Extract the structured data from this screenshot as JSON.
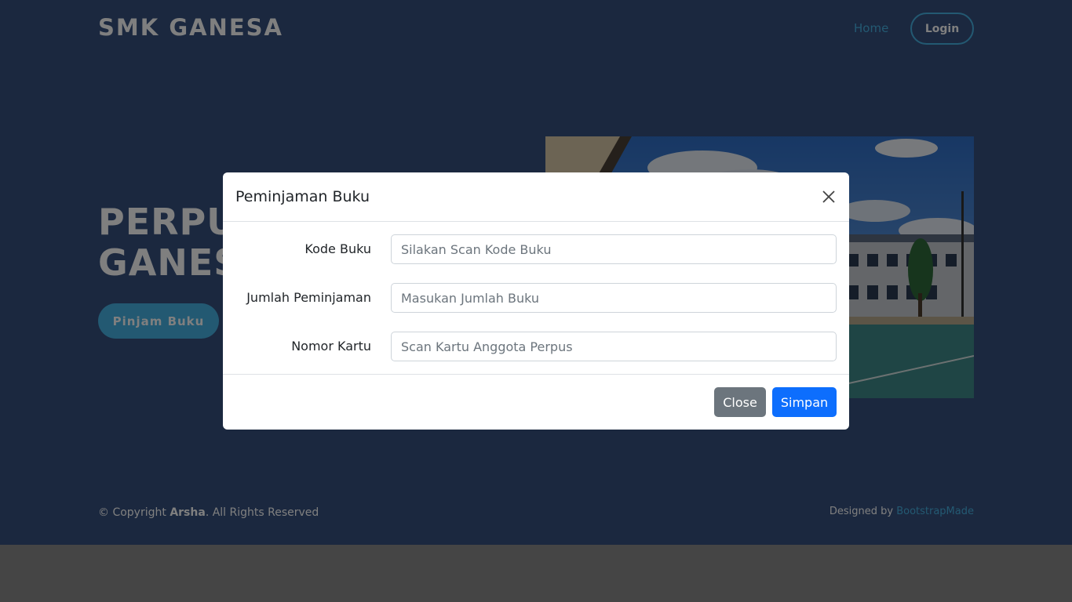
{
  "header": {
    "logo": "SMK GANESA",
    "nav_home": "Home",
    "nav_login": "Login"
  },
  "hero": {
    "title_line1": "PERPUS",
    "title_line2": "GANES",
    "button": "Pinjam Buku",
    "image_icon": "school-building-photo"
  },
  "footer": {
    "copyright_prefix": "© Copyright",
    "copyright_brand": "Arsha",
    "copyright_suffix": ". All Rights Reserved",
    "designed_by": "Designed by",
    "designed_by_link": "BootstrapMade"
  },
  "modal": {
    "title": "Peminjaman Buku",
    "close_icon": "close-icon",
    "fields": [
      {
        "label": "Kode Buku",
        "placeholder": "Silakan Scan Kode Buku",
        "value": ""
      },
      {
        "label": "Jumlah Peminjaman",
        "placeholder": "Masukan Jumlah Buku",
        "value": ""
      },
      {
        "label": "Nomor Kartu",
        "placeholder": "Scan Kartu Anggota Perpus",
        "value": ""
      }
    ],
    "close_button": "Close",
    "save_button": "Simpan"
  },
  "colors": {
    "page_bg": "#37517e",
    "accent": "#47b2e4",
    "primary": "#0d6efd",
    "secondary": "#6c757d"
  }
}
